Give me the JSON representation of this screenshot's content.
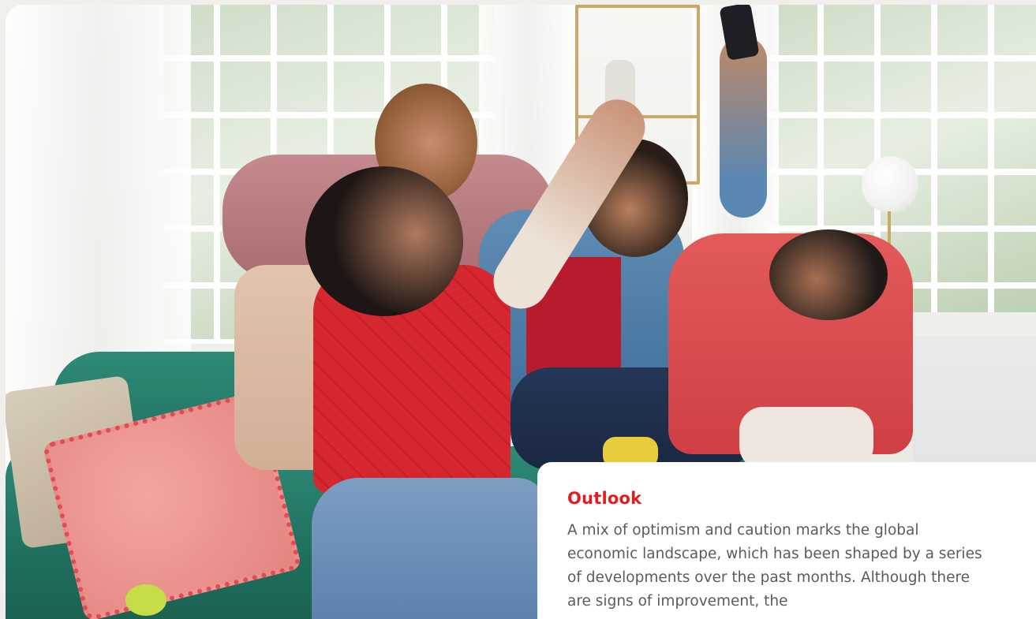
{
  "outlook": {
    "heading": "Outlook",
    "body": "A mix of optimism and caution marks the global economic landscape, which has been shaped by a series of developments over the past months. Although there are signs of improvement, the"
  },
  "colors": {
    "accent": "#e11d20",
    "body_text": "#5b5b5b",
    "card_background": "#ffffff",
    "sofa": "#2e8a76"
  }
}
